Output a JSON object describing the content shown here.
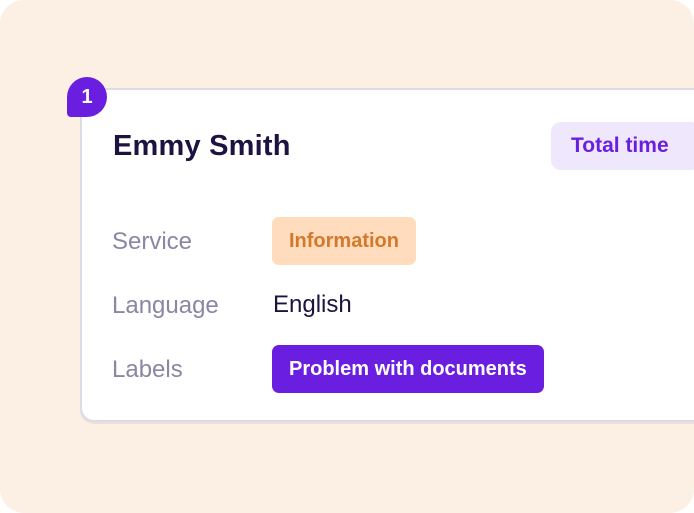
{
  "badge": {
    "number": "1"
  },
  "card": {
    "name": "Emmy Smith",
    "total_time_label": "Total time",
    "rows": [
      {
        "label": "Service",
        "value": "Information"
      },
      {
        "label": "Language",
        "value": "English"
      },
      {
        "label": "Labels",
        "value": "Problem with documents"
      }
    ]
  },
  "colors": {
    "background": "#fbf0e3",
    "accent": "#6a1fe0",
    "service_tag_bg": "#ffdcbd",
    "service_tag_text": "#d27a2c",
    "total_time_bg": "#efe7fb",
    "muted_text": "#8a86a3",
    "primary_text": "#1d1240"
  }
}
